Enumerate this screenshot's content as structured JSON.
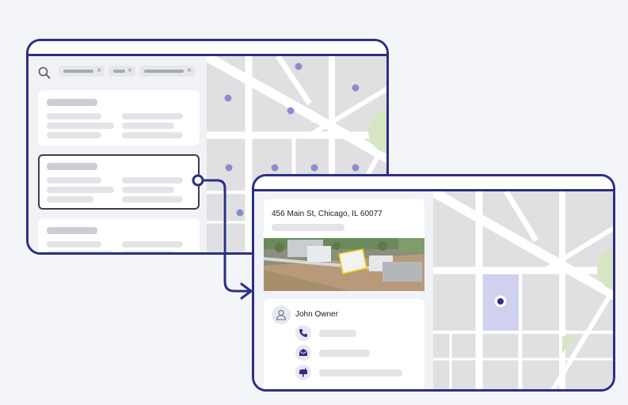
{
  "search": {
    "icon": "search-icon",
    "filters": [
      {
        "remove": "×"
      },
      {
        "remove": "×"
      },
      {
        "remove": "×"
      }
    ]
  },
  "detail": {
    "address": "456 Main St, Chicago, IL 60077",
    "owner_name": "John Owner",
    "contact_icons": [
      "phone-icon",
      "mail-icon",
      "mailbox-icon"
    ]
  },
  "colors": {
    "frame": "#2d2e86",
    "map_block": "#e0e0e2",
    "map_road": "#ffffff",
    "park": "#d6e6c4",
    "marker": "#8a8ecb",
    "selected_parcel": "#cfd1ee"
  }
}
